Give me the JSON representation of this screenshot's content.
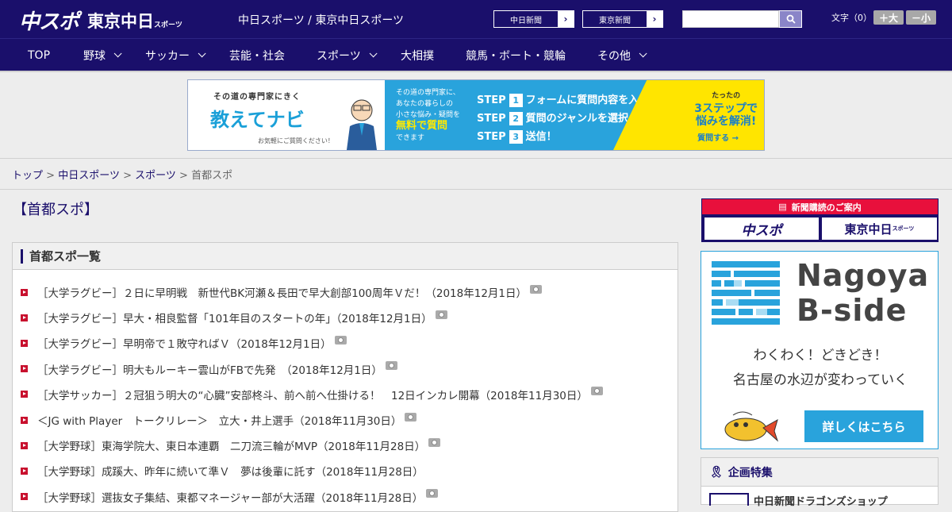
{
  "header": {
    "logo_chuspo": "中スポ",
    "logo_tokyo": "東京中日",
    "logo_tokyo_sub": "スポーツ",
    "site_title": "中日スポーツ / 東京中日スポーツ",
    "paper_links": [
      "中日新聞",
      "東京新聞"
    ],
    "search": {
      "value": ""
    },
    "font_size_label": "文字（0）",
    "font_bigger": "＋大",
    "font_smaller": "－小"
  },
  "nav": {
    "items": [
      {
        "label": "TOP"
      },
      {
        "label": "野球"
      },
      {
        "label": "サッカー"
      },
      {
        "label": "芸能・社会"
      },
      {
        "label": "スポーツ"
      },
      {
        "label": "大相撲"
      },
      {
        "label": "競馬・ボート・競輪"
      },
      {
        "label": "その他"
      }
    ]
  },
  "banner": {
    "sub": "その道の専門家にきく",
    "title": "教えてナビ",
    "small": "お気軽にご質問ください！",
    "mid_text_1": "その道の専門家に、",
    "mid_text_2": "あなたの暮らしの",
    "mid_text_3": "小さな悩み・疑問を",
    "mid_highlight": "無料で質問",
    "mid_text_4": "できます",
    "steps": [
      {
        "label": "STEP",
        "num": "1",
        "text": "フォームに質問内容を入力"
      },
      {
        "label": "STEP",
        "num": "2",
        "text": "質問のジャンルを選択"
      },
      {
        "label": "STEP",
        "num": "3",
        "text": "送信！"
      }
    ],
    "right_small": "たったの",
    "right_big": "3ステップで",
    "right_big2": "悩みを解消!",
    "question_btn": "質問する →"
  },
  "breadcrumb": {
    "items": [
      "トップ",
      "中日スポーツ",
      "スポーツ"
    ],
    "current": "首都スポ",
    "sep": ">"
  },
  "main": {
    "title": "【首都スポ】",
    "list_title": "首都スポ一覧",
    "articles": [
      {
        "text": "［大学ラグビー］２日に早明戦　新世代BK河瀬＆長田で早大創部100周年Ｖだ！（2018年12月1日）",
        "photo": true
      },
      {
        "text": "［大学ラグビー］早大・相良監督「101年目のスタートの年」（2018年12月1日）",
        "photo": true
      },
      {
        "text": "［大学ラグビー］早明帝で１敗守ればＶ（2018年12月1日）",
        "photo": true
      },
      {
        "text": "［大学ラグビー］明大もルーキー雲山がFBで先発　（2018年12月1日）",
        "photo": true
      },
      {
        "text": "［大学サッカー］２冠狙う明大の“心臓”安部柊斗、前へ前へ仕掛ける！　12日インカレ開幕（2018年11月30日）",
        "photo": true
      },
      {
        "text": "＜JG with Player　トークリレー＞　立大・井上選手（2018年11月30日）",
        "photo": true
      },
      {
        "text": "［大学野球］東海学院大、東日本連覇　二刀流三輪がMVP（2018年11月28日）",
        "photo": true
      },
      {
        "text": "［大学野球］成蹊大、昨年に続いて準Ｖ　夢は後輩に託す（2018年11月28日）",
        "photo": false
      },
      {
        "text": "［大学野球］選抜女子集結、東都マネージャー部が大活躍（2018年11月28日）",
        "photo": true
      }
    ]
  },
  "sidebar": {
    "subscribe_head": "新聞購読のご案内",
    "subscribe_logo1": "中スポ",
    "subscribe_logo2": "東京中日",
    "subscribe_logo2_sub": "スポーツ",
    "ad_title_1": "Nagoya",
    "ad_title_2": "B-side",
    "ad_tag_1": "わくわく！どきどき！",
    "ad_tag_2": "名古屋の水辺が変わっていく",
    "ad_cta": "詳しくはこちら",
    "kikaku_head": "企画特集",
    "kikaku_item": "中日新聞ドラゴンズショップ"
  },
  "colors": {
    "brand_navy": "#1a0f6b",
    "accent_red": "#c8102e",
    "accent_blue": "#29a3dc",
    "banner_yellow": "#ffe500"
  }
}
